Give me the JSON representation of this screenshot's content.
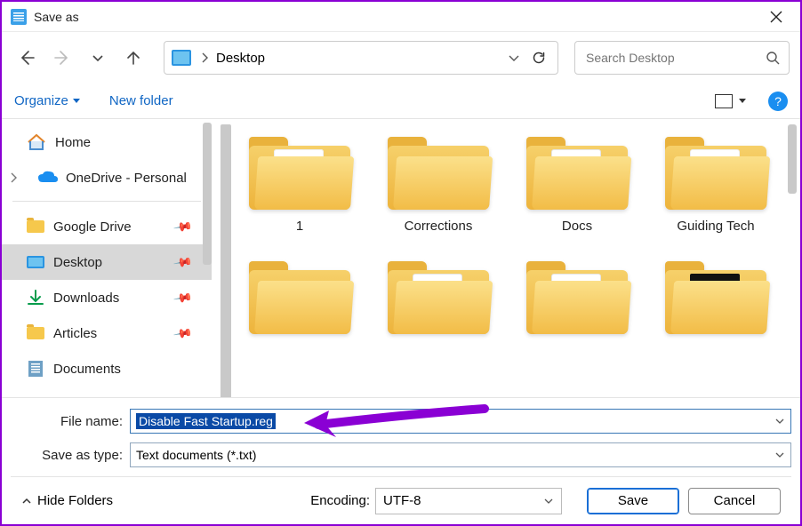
{
  "window": {
    "title": "Save as"
  },
  "nav": {
    "location": "Desktop",
    "search_placeholder": "Search Desktop"
  },
  "toolbar": {
    "organize": "Organize",
    "newfolder": "New folder"
  },
  "sidebar": {
    "home": "Home",
    "onedrive": "OneDrive - Personal",
    "items": [
      {
        "label": "Google Drive"
      },
      {
        "label": "Desktop"
      },
      {
        "label": "Downloads"
      },
      {
        "label": "Articles"
      },
      {
        "label": "Documents"
      }
    ]
  },
  "grid": {
    "items": [
      {
        "label": "1"
      },
      {
        "label": "Corrections"
      },
      {
        "label": "Docs"
      },
      {
        "label": "Guiding Tech"
      },
      {
        "label": ""
      },
      {
        "label": ""
      },
      {
        "label": ""
      },
      {
        "label": ""
      }
    ]
  },
  "fields": {
    "filename_label": "File name:",
    "filename_value": "Disable Fast Startup.reg",
    "type_label": "Save as type:",
    "type_value": "Text documents (*.txt)"
  },
  "footer": {
    "hide": "Hide Folders",
    "encoding_label": "Encoding:",
    "encoding_value": "UTF-8",
    "save": "Save",
    "cancel": "Cancel"
  }
}
